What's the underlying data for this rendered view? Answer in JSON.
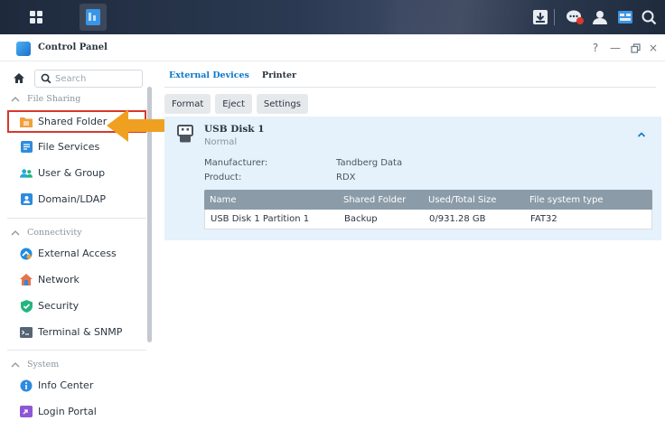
{
  "window": {
    "title": "Control Panel",
    "controls": [
      "?",
      "—",
      "restore",
      "×"
    ]
  },
  "taskbar": {
    "icons": [
      "grid-icon",
      "control-panel-icon",
      "download-icon",
      "chat-icon",
      "user-icon",
      "widgets-icon",
      "search-icon"
    ]
  },
  "sidebar": {
    "search_placeholder": "Search",
    "sections": [
      {
        "label": "File Sharing",
        "items": [
          {
            "label": "Shared Folder",
            "icon": "shared-folder-icon",
            "selected": true,
            "color": "#f0a03c"
          },
          {
            "label": "File Services",
            "icon": "file-services-icon",
            "color": "#2d8be0"
          },
          {
            "label": "User & Group",
            "icon": "user-group-icon",
            "color": "#2aa7d6"
          },
          {
            "label": "Domain/LDAP",
            "icon": "domain-ldap-icon",
            "color": "#2d8be0"
          }
        ]
      },
      {
        "label": "Connectivity",
        "items": [
          {
            "label": "External Access",
            "icon": "external-access-icon",
            "color": "#1f8de0"
          },
          {
            "label": "Network",
            "icon": "network-icon",
            "color": "#e8734a"
          },
          {
            "label": "Security",
            "icon": "security-icon",
            "color": "#24b57f"
          },
          {
            "label": "Terminal & SNMP",
            "icon": "terminal-icon",
            "color": "#566575"
          }
        ]
      },
      {
        "label": "System",
        "items": [
          {
            "label": "Info Center",
            "icon": "info-center-icon",
            "color": "#2d8be0"
          },
          {
            "label": "Login Portal",
            "icon": "login-portal-icon",
            "color": "#8e57d6"
          }
        ]
      }
    ]
  },
  "main": {
    "tabs": [
      {
        "label": "External Devices",
        "active": true
      },
      {
        "label": "Printer",
        "active": false
      }
    ],
    "toolbar": {
      "format": "Format",
      "eject": "Eject",
      "settings": "Settings"
    },
    "device": {
      "name": "USB Disk 1",
      "status": "Normal",
      "manufacturer_label": "Manufacturer:",
      "manufacturer": "Tandberg Data",
      "product_label": "Product:",
      "product": "RDX",
      "table": {
        "headers": [
          "Name",
          "Shared Folder",
          "Used/Total Size",
          "File system type"
        ],
        "rows": [
          [
            "USB Disk 1 Partition 1",
            "Backup",
            "0/931.28 GB",
            "FAT32"
          ]
        ]
      }
    }
  },
  "colors": {
    "accent": "#0a78c9",
    "highlight_border": "#d6392b",
    "arrow": "#f0a020",
    "panel_bg": "#e5f1fb"
  }
}
